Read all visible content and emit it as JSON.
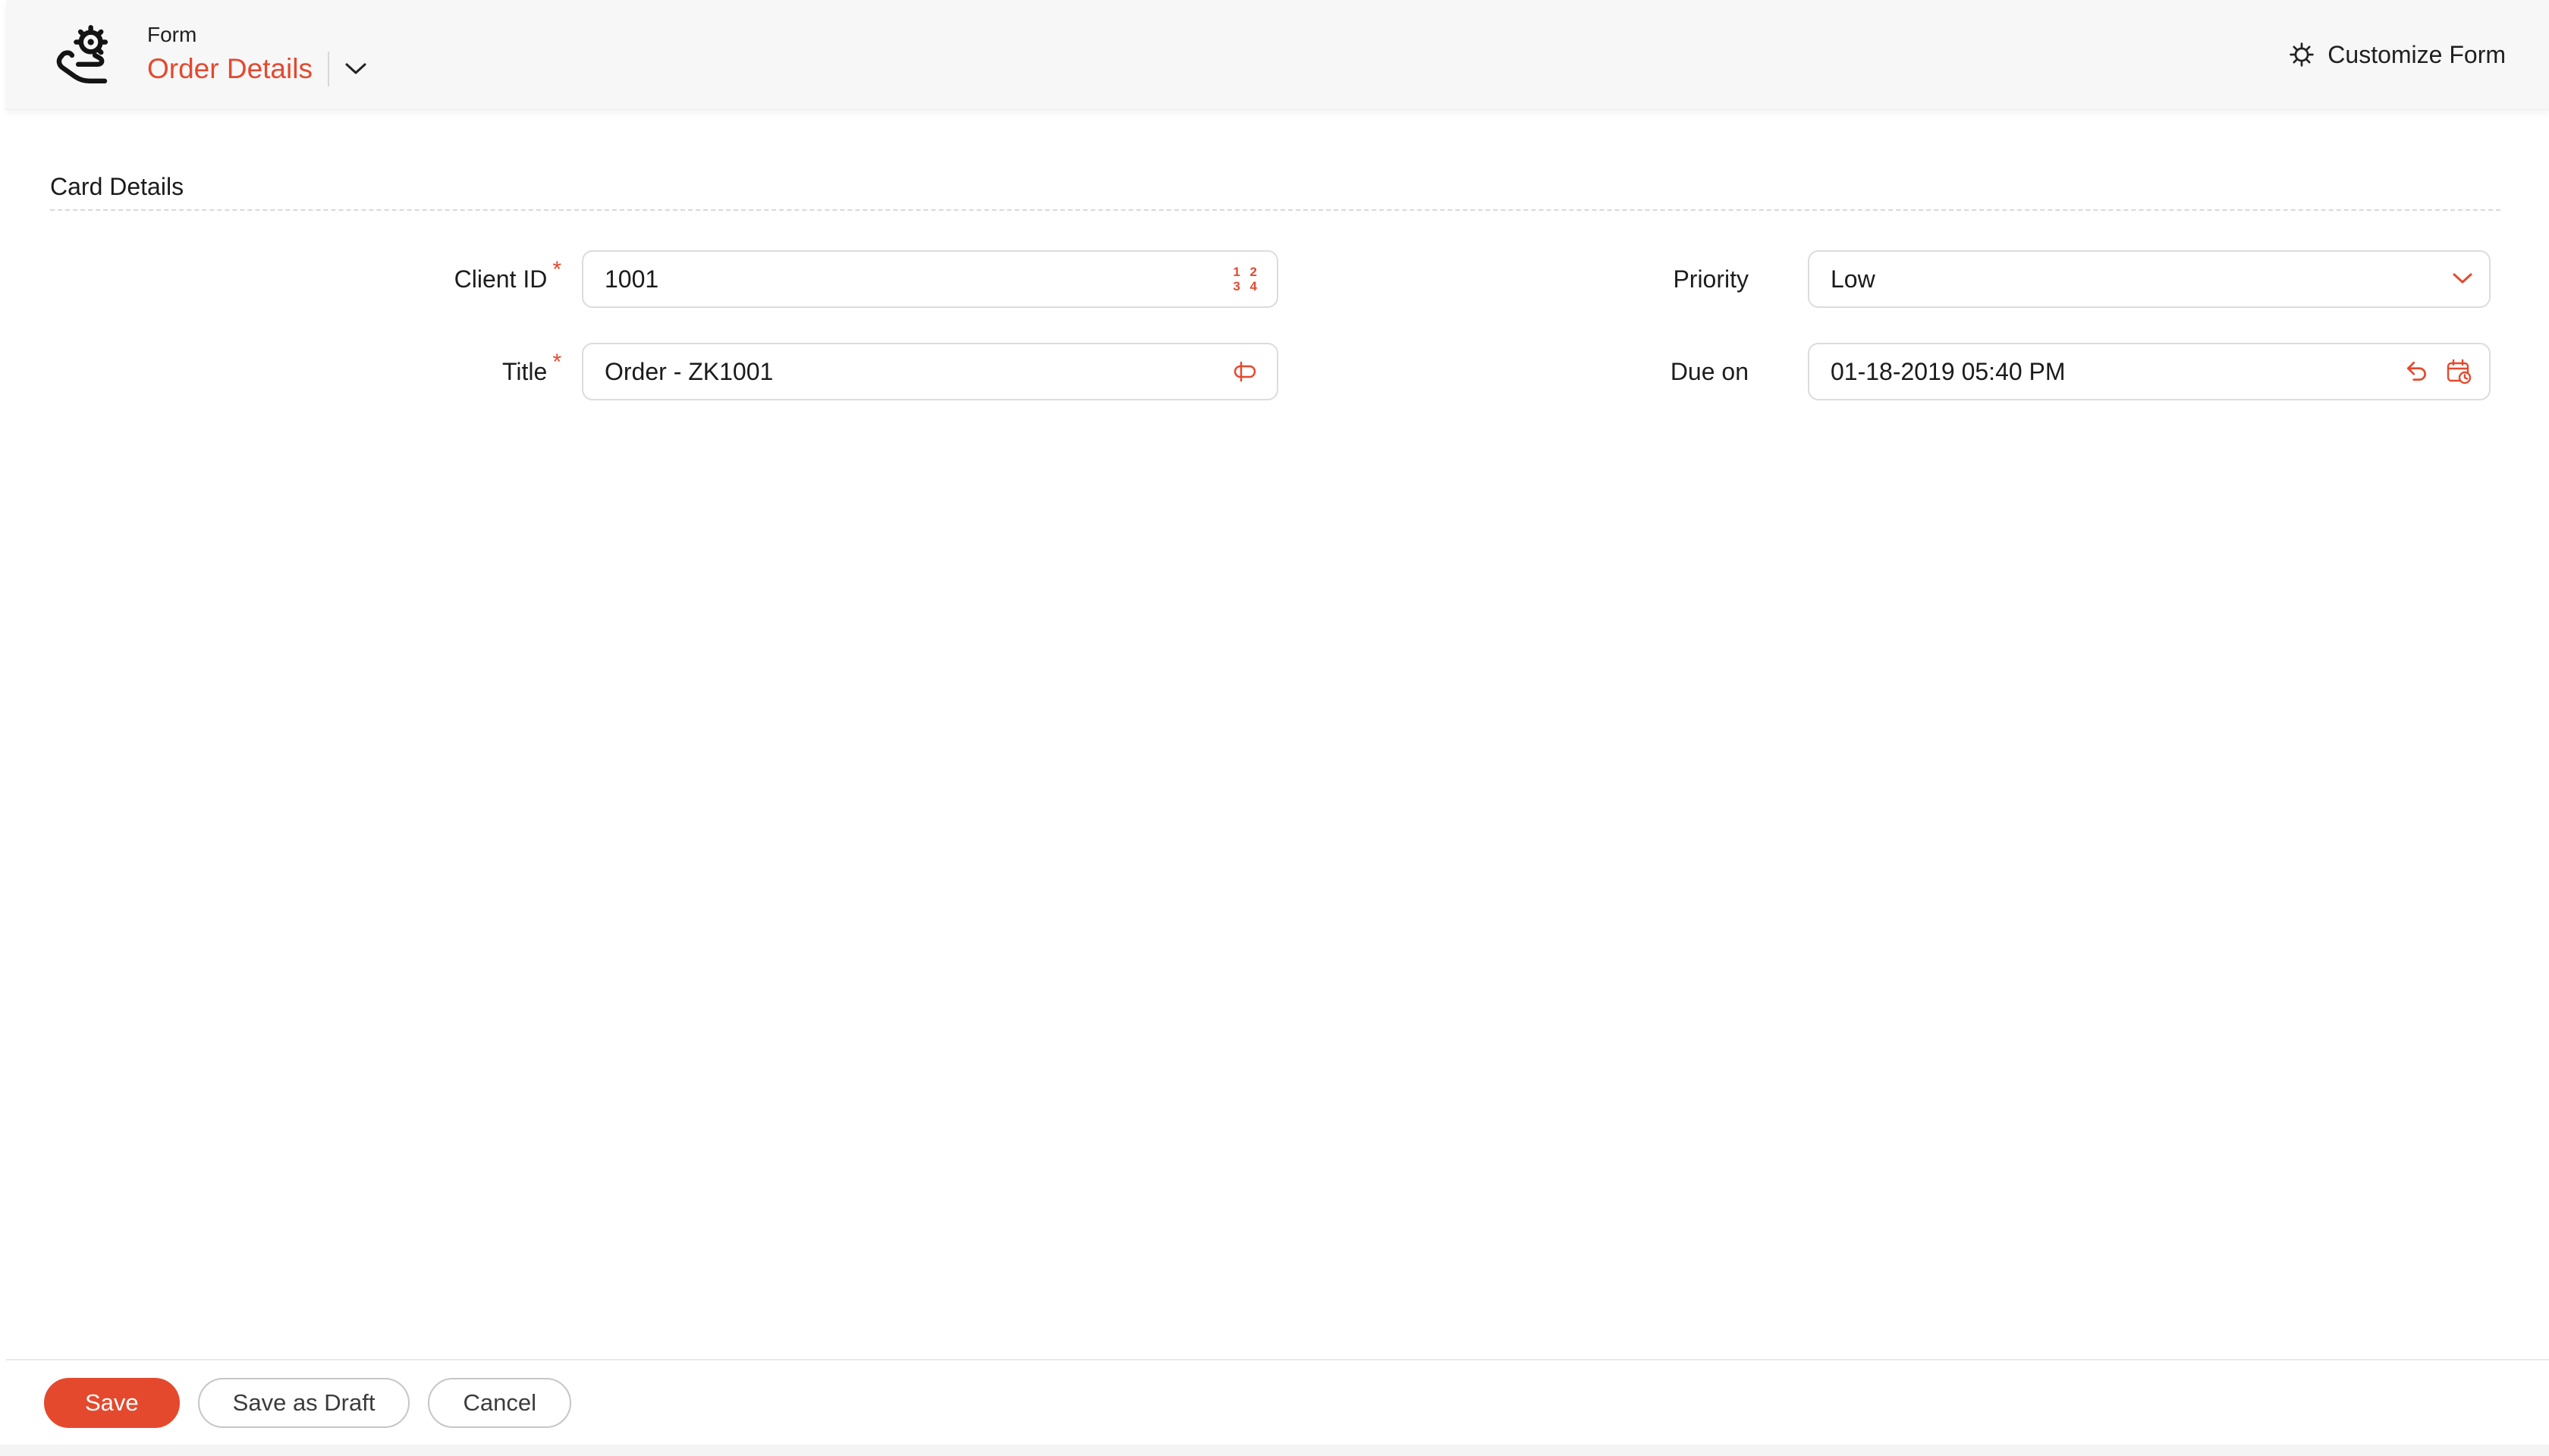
{
  "colors": {
    "accent": "#e4492e",
    "header_bg": "#f7f7f8",
    "input_border": "#dcdcdc",
    "button_border": "#c6c6c6"
  },
  "header": {
    "logo_icon": "hand-gear-logo-icon",
    "form_label": "Form",
    "title": "Order Details",
    "title_dropdown_icon": "chevron-down-icon",
    "customize_icon": "gear-icon",
    "customize_label": "Customize Form"
  },
  "section": {
    "title": "Card Details"
  },
  "fields": {
    "client_id": {
      "label": "Client ID",
      "required_mark": "*",
      "value": "1001",
      "type_icon": "number-field-icon",
      "icon_digits_top": "1 2",
      "icon_digits_bottom": "3 4"
    },
    "title": {
      "label": "Title",
      "required_mark": "*",
      "value": "Order - ZK1001",
      "type_icon": "text-field-icon"
    },
    "priority": {
      "label": "Priority",
      "value": "Low",
      "type_icon": "chevron-down-icon"
    },
    "due_on": {
      "label": "Due on",
      "value": "01-18-2019 05:40 PM",
      "icons": "undo-icon calendar-clock-icon"
    }
  },
  "footer": {
    "save": "Save",
    "save_as_draft": "Save as Draft",
    "cancel": "Cancel"
  }
}
